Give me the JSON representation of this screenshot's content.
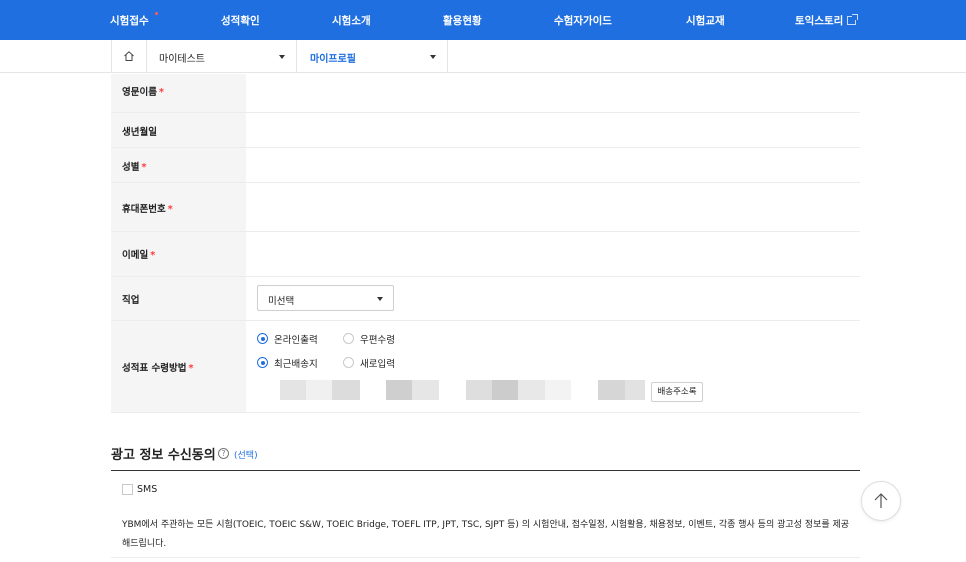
{
  "nav": {
    "items": [
      "시험접수",
      "성적확인",
      "시험소개",
      "활용현황",
      "수험자가이드",
      "시험교재",
      "토익스토리"
    ]
  },
  "breadcrumb": {
    "home_icon": "home-icon",
    "level1": "마이테스트",
    "level2": "마이프로필"
  },
  "form": {
    "english_name_label": "영문이름",
    "birth_label": "생년월일",
    "gender_label": "성별",
    "phone_label": "휴대폰번호",
    "email_label": "이메일",
    "job_label": "직업",
    "job_selected": "미선택",
    "report_label": "성적표 수령방법",
    "required_mark": "*",
    "report_options": [
      "온라인출력",
      "우편수령"
    ],
    "address_options": [
      "최근배송지",
      "새로입력"
    ],
    "address_book_button": "배송주소록"
  },
  "ad_section": {
    "title": "광고 정보 수신동의",
    "help_icon": "question-circle-icon",
    "help_glyph": "?",
    "optional": "(선택)",
    "sms_label": "SMS",
    "description": "YBM에서 주관하는 모든 시험(TOEIC, TOEIC S&W, TOEIC Bridge, TOEFL ITP, JPT, TSC, SJPT 등) 의 시험안내, 접수일정, 시험활용, 채용정보, 이벤트, 각종 행사 등의 광고성 정보를 제공해드립니다."
  },
  "colors": {
    "brand": "#1f6fe0",
    "required": "#ff3b3b"
  }
}
